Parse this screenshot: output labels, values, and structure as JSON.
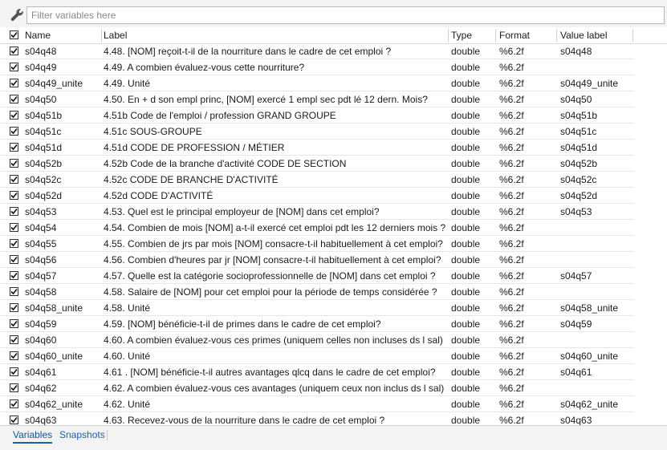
{
  "filter": {
    "placeholder": "Filter variables here",
    "icon": "wrench-icon"
  },
  "header": {
    "name": "Name",
    "label": "Label",
    "type": "Type",
    "format": "Format",
    "value_label": "Value label"
  },
  "rows": [
    {
      "name": "s04q48",
      "label": "4.48. [NOM] reçoit-t-il de la  nourriture  dans le cadre de cet emploi ?",
      "type": "double",
      "format": "%6.2f",
      "value_label": "s04q48"
    },
    {
      "name": "s04q49",
      "label": "4.49. A combien évaluez-vous cette nourriture?",
      "type": "double",
      "format": "%6.2f",
      "value_label": ""
    },
    {
      "name": "s04q49_unite",
      "label": "4.49. Unité",
      "type": "double",
      "format": "%6.2f",
      "value_label": "s04q49_unite"
    },
    {
      "name": "s04q50",
      "label": "4.50. En + d son empl princ, [NOM] exercé 1 empl sec pdt lé 12 dern. Mois?",
      "type": "double",
      "format": "%6.2f",
      "value_label": "s04q50"
    },
    {
      "name": "s04q51b",
      "label": "4.51b Code de l'emploi / profession GRAND GROUPE",
      "type": "double",
      "format": "%6.2f",
      "value_label": "s04q51b"
    },
    {
      "name": "s04q51c",
      "label": "4.51c SOUS-GROUPE",
      "type": "double",
      "format": "%6.2f",
      "value_label": "s04q51c"
    },
    {
      "name": "s04q51d",
      "label": "4.51d CODE DE PROFESSION / MÉTIER",
      "type": "double",
      "format": "%6.2f",
      "value_label": "s04q51d"
    },
    {
      "name": "s04q52b",
      "label": "4.52b Code de la branche d'activité CODE DE SECTION",
      "type": "double",
      "format": "%6.2f",
      "value_label": "s04q52b"
    },
    {
      "name": "s04q52c",
      "label": "4.52c CODE DE BRANCHE D'ACTIVITÉ",
      "type": "double",
      "format": "%6.2f",
      "value_label": "s04q52c"
    },
    {
      "name": "s04q52d",
      "label": "4.52d CODE D'ACTIVITÉ",
      "type": "double",
      "format": "%6.2f",
      "value_label": "s04q52d"
    },
    {
      "name": "s04q53",
      "label": "4.53. Quel est le principal employeur de [NOM]  dans cet emploi?",
      "type": "double",
      "format": "%6.2f",
      "value_label": "s04q53"
    },
    {
      "name": "s04q54",
      "label": "4.54. Combien de mois [NOM] a-t-il exercé cet emploi pdt les 12 derniers mois ?",
      "type": "double",
      "format": "%6.2f",
      "value_label": ""
    },
    {
      "name": "s04q55",
      "label": "4.55. Combien de jrs par mois [NOM] consacre-t-il habituellement à cet emploi?",
      "type": "double",
      "format": "%6.2f",
      "value_label": ""
    },
    {
      "name": "s04q56",
      "label": "4.56. Combien d'heures par jr [NOM] consacre-t-il habituellement à cet emploi?",
      "type": "double",
      "format": "%6.2f",
      "value_label": ""
    },
    {
      "name": "s04q57",
      "label": "4.57. Quelle est la catégorie socioprofessionnelle de [NOM] dans cet emploi ?",
      "type": "double",
      "format": "%6.2f",
      "value_label": "s04q57"
    },
    {
      "name": "s04q58",
      "label": "4.58. Salaire de  [NOM] pour cet emploi pour la période de temps considérée ?",
      "type": "double",
      "format": "%6.2f",
      "value_label": ""
    },
    {
      "name": "s04q58_unite",
      "label": "4.58. Unité",
      "type": "double",
      "format": "%6.2f",
      "value_label": "s04q58_unite"
    },
    {
      "name": "s04q59",
      "label": "4.59. [NOM]  bénéficie-t-il de primes dans le cadre de cet emploi?",
      "type": "double",
      "format": "%6.2f",
      "value_label": "s04q59"
    },
    {
      "name": "s04q60",
      "label": "4.60. A combien évaluez-vous ces primes (uniquem celles non incluses ds l sal)",
      "type": "double",
      "format": "%6.2f",
      "value_label": ""
    },
    {
      "name": "s04q60_unite",
      "label": "4.60. Unité",
      "type": "double",
      "format": "%6.2f",
      "value_label": "s04q60_unite"
    },
    {
      "name": "s04q61",
      "label": "4.61 . [NOM] bénéficie-t-il autres avantages qlcq dans le cadre de cet emploi?",
      "type": "double",
      "format": "%6.2f",
      "value_label": "s04q61"
    },
    {
      "name": "s04q62",
      "label": "4.62. A combien évaluez-vous ces avantages (uniquem ceux non inclus ds l sal)",
      "type": "double",
      "format": "%6.2f",
      "value_label": ""
    },
    {
      "name": "s04q62_unite",
      "label": "4.62. Unité",
      "type": "double",
      "format": "%6.2f",
      "value_label": "s04q62_unite"
    },
    {
      "name": "s04q63",
      "label": "4.63. Recevez-vous de la nourriture dans le cadre de cet emploi ?",
      "type": "double",
      "format": "%6.2f",
      "value_label": "s04q63"
    }
  ],
  "tabs": [
    {
      "label": "Variables",
      "active": true
    },
    {
      "label": "Snapshots",
      "active": false
    }
  ]
}
